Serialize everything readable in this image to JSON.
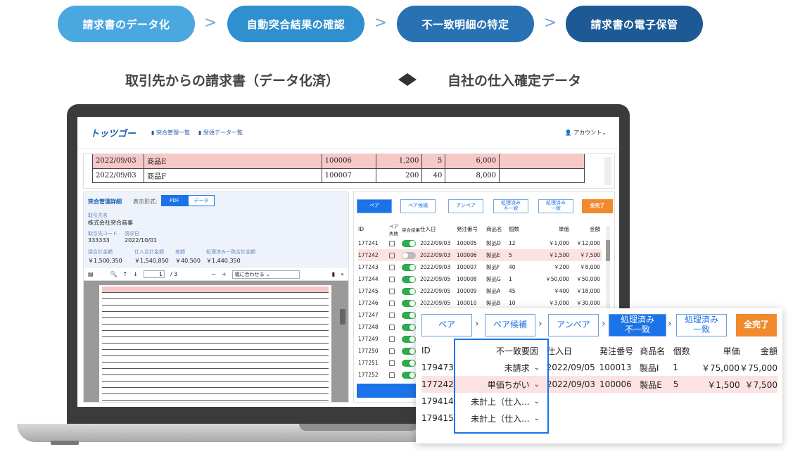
{
  "steps": [
    {
      "label": "請求書のデータ化",
      "color": "#4aa7e0"
    },
    {
      "label": "自動突合結果の確認",
      "color": "#2f8fcf"
    },
    {
      "label": "不一致明細の特定",
      "color": "#2872b3"
    },
    {
      "label": "請求書の電子保管",
      "color": "#1d5a95"
    }
  ],
  "headline": {
    "left": "取引先からの請求書（データ化済）",
    "right": "自社の仕入確定データ"
  },
  "app": {
    "logo": "トッツゴー",
    "nav1": "突合管理一覧",
    "nav2": "受領データ一覧",
    "account": "アカウント"
  },
  "doc_rows": [
    {
      "date": "2022/09/03",
      "product": "商品E",
      "no": "100006",
      "price": "1,200",
      "qty": "5",
      "amount": "6,000"
    },
    {
      "date": "2022/09/03",
      "product": "商品F",
      "no": "100007",
      "price": "200",
      "qty": "40",
      "amount": "8,000"
    }
  ],
  "detail": {
    "title": "突合管理詳細",
    "format_label": "表示形式:",
    "fmt_pdf": "PDF",
    "fmt_data": "データ",
    "partner_label": "取引先名",
    "partner": "株式会社突合商事",
    "code_label": "取引先コード",
    "code": "333333",
    "date_label": "請求日",
    "date": "2022/10/01",
    "inv_total_label": "請合計金額",
    "inv_total": "￥1,500,350",
    "buy_total_label": "仕入合計金額",
    "buy_total": "￥1,540,850",
    "diff_label": "差額",
    "diff": "￥40,500",
    "done_total_label": "処理済み一致合計金額",
    "done_total": "￥1,440,350",
    "page": "1",
    "pages": "/ 3",
    "zoom": "幅に合わせる"
  },
  "tabs": {
    "pair": "ペア",
    "pair_cand": "ペア候補",
    "unpair": "アンペア",
    "done_mismatch": "処理済み\n不一致",
    "done_match": "処理済み\n一致",
    "complete": "全完了"
  },
  "table_head": {
    "id": "ID",
    "pair_fail": "ペア失敗",
    "result": "突合結果",
    "date": "仕入日",
    "order_no": "発注番号",
    "product": "商品名",
    "qty": "個数",
    "unit": "単価",
    "amount": "金額"
  },
  "rows": [
    {
      "id": "177241",
      "on": true,
      "date": "2022/09/03",
      "no": "100005",
      "product": "製品D",
      "qty": "12",
      "unit": "￥1,000",
      "amount": "￥12,000",
      "hl": false
    },
    {
      "id": "177242",
      "on": false,
      "date": "2022/09/03",
      "no": "100006",
      "product": "製品E",
      "qty": "5",
      "unit": "￥1,500",
      "amount": "￥7,500",
      "hl": true
    },
    {
      "id": "177243",
      "on": true,
      "date": "2022/09/03",
      "no": "100007",
      "product": "製品F",
      "qty": "40",
      "unit": "￥200",
      "amount": "￥8,000",
      "hl": false
    },
    {
      "id": "177244",
      "on": true,
      "date": "2022/09/05",
      "no": "100008",
      "product": "製品G",
      "qty": "1",
      "unit": "￥50,000",
      "amount": "￥50,000",
      "hl": false
    },
    {
      "id": "177245",
      "on": true,
      "date": "2022/09/05",
      "no": "100009",
      "product": "製品A",
      "qty": "45",
      "unit": "￥400",
      "amount": "￥18,000",
      "hl": false
    },
    {
      "id": "177246",
      "on": true,
      "date": "2022/09/05",
      "no": "100010",
      "product": "製品B",
      "qty": "10",
      "unit": "￥3,000",
      "amount": "￥30,000",
      "hl": false
    },
    {
      "id": "177247",
      "on": true,
      "date": "",
      "no": "",
      "product": "",
      "qty": "",
      "unit": "",
      "amount": "",
      "hl": false
    },
    {
      "id": "177248",
      "on": true,
      "date": "",
      "no": "",
      "product": "",
      "qty": "",
      "unit": "",
      "amount": "",
      "hl": false
    },
    {
      "id": "177249",
      "on": true,
      "date": "",
      "no": "",
      "product": "",
      "qty": "",
      "unit": "",
      "amount": "",
      "hl": false
    },
    {
      "id": "177250",
      "on": true,
      "date": "",
      "no": "",
      "product": "",
      "qty": "",
      "unit": "",
      "amount": "",
      "hl": false
    },
    {
      "id": "177251",
      "on": true,
      "date": "",
      "no": "",
      "product": "",
      "qty": "",
      "unit": "",
      "amount": "",
      "hl": false
    },
    {
      "id": "177252",
      "on": true,
      "date": "",
      "no": "",
      "product": "",
      "qty": "",
      "unit": "",
      "amount": "",
      "hl": false
    }
  ],
  "popup": {
    "cause_header": "不一致要因",
    "id_header": "ID",
    "date_header": "仕入日",
    "rows": [
      {
        "id": "179473",
        "cause": "未請求",
        "date": "2022/09/05",
        "no": "100013",
        "product": "製品I",
        "qty": "1",
        "unit": "￥75,000",
        "amount": "￥75,000",
        "hl": false
      },
      {
        "id": "177242",
        "cause": "単価ちがい",
        "date": "2022/09/03",
        "no": "100006",
        "product": "製品E",
        "qty": "5",
        "unit": "￥1,500",
        "amount": "￥7,500",
        "hl": true
      },
      {
        "id": "179414",
        "cause": "未計上（仕入...",
        "date": "",
        "no": "",
        "product": "",
        "qty": "",
        "unit": "",
        "amount": "",
        "hl": false
      },
      {
        "id": "179415",
        "cause": "未計上（仕入...",
        "date": "",
        "no": "",
        "product": "",
        "qty": "",
        "unit": "",
        "amount": "",
        "hl": false
      }
    ]
  },
  "colors": {
    "accent": "#1a73e8",
    "orange": "#f08a2c",
    "highlight": "#fde2e2"
  }
}
